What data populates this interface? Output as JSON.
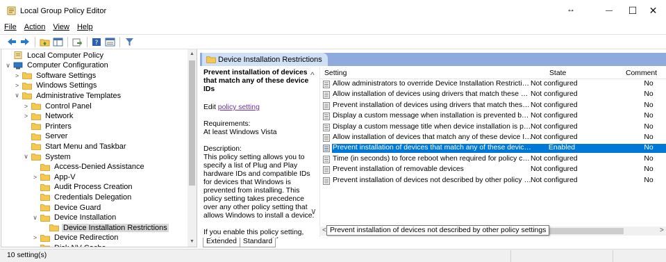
{
  "window": {
    "title": "Local Group Policy Editor",
    "resize_glyph": "↔",
    "minimize": "—",
    "maximize": "☐",
    "close": "✕"
  },
  "menu": [
    "File",
    "Action",
    "View",
    "Help"
  ],
  "toolbar_icons": [
    "back-icon",
    "forward-icon",
    "up-folder-icon",
    "show-hide-tree-icon",
    "export-icon",
    "help-icon",
    "properties-icon",
    "filter-icon"
  ],
  "tree": {
    "items": [
      {
        "label": "Local Computer Policy",
        "chev": "",
        "icon": "policy"
      },
      {
        "label": "Computer Configuration",
        "chev": "∨",
        "icon": "computer"
      },
      {
        "label": "Software Settings",
        "chev": ">",
        "icon": "folder"
      },
      {
        "label": "Windows Settings",
        "chev": ">",
        "icon": "folder"
      },
      {
        "label": "Administrative Templates",
        "chev": "∨",
        "icon": "folder"
      },
      {
        "label": "Control Panel",
        "chev": ">",
        "icon": "folder"
      },
      {
        "label": "Network",
        "chev": ">",
        "icon": "folder"
      },
      {
        "label": "Printers",
        "chev": "",
        "icon": "folder"
      },
      {
        "label": "Server",
        "chev": "",
        "icon": "folder"
      },
      {
        "label": "Start Menu and Taskbar",
        "chev": "",
        "icon": "folder"
      },
      {
        "label": "System",
        "chev": "∨",
        "icon": "folder"
      },
      {
        "label": "Access-Denied Assistance",
        "chev": "",
        "icon": "folder"
      },
      {
        "label": "App-V",
        "chev": ">",
        "icon": "folder"
      },
      {
        "label": "Audit Process Creation",
        "chev": "",
        "icon": "folder"
      },
      {
        "label": "Credentials Delegation",
        "chev": "",
        "icon": "folder"
      },
      {
        "label": "Device Guard",
        "chev": "",
        "icon": "folder"
      },
      {
        "label": "Device Installation",
        "chev": "∨",
        "icon": "folder"
      },
      {
        "label": "Device Installation Restrictions",
        "chev": "",
        "icon": "folder",
        "selected": true
      },
      {
        "label": "Device Redirection",
        "chev": ">",
        "icon": "folder"
      },
      {
        "label": "Disk NV Cache",
        "chev": "",
        "icon": "folder"
      }
    ]
  },
  "header": {
    "tab": "Device Installation Restrictions"
  },
  "description": {
    "title": "Prevent installation of devices that match any of these device IDs",
    "edit_prefix": "Edit ",
    "edit_link": "policy setting",
    "req_label": "Requirements:",
    "req_value": "At least Windows Vista",
    "desc_label": "Description:",
    "desc_text": "This policy setting allows you to specify a list of Plug and Play hardware IDs and compatible IDs for devices that Windows is prevented from installing. This policy setting takes precedence over any other policy setting that allows Windows to install a device.",
    "enable_text": "If you enable this policy setting, Windows is prevented from"
  },
  "list": {
    "columns": {
      "setting": "Setting",
      "state": "State",
      "comment": "Comment"
    },
    "rows": [
      {
        "setting": "Allow administrators to override Device Installation Restriction p...",
        "state": "Not configured",
        "comment": "No"
      },
      {
        "setting": "Allow installation of devices using drivers that match these devi...",
        "state": "Not configured",
        "comment": "No"
      },
      {
        "setting": "Prevent installation of devices using drivers that match these de...",
        "state": "Not configured",
        "comment": "No"
      },
      {
        "setting": "Display a custom message when installation is prevented by a p...",
        "state": "Not configured",
        "comment": "No"
      },
      {
        "setting": "Display a custom message title when device installation is preve...",
        "state": "Not configured",
        "comment": "No"
      },
      {
        "setting": "Allow installation of devices that match any of these device IDs",
        "state": "Not configured",
        "comment": "No"
      },
      {
        "setting": "Prevent installation of devices that match any of these device IDs",
        "state": "Enabled",
        "comment": "No",
        "selected": true
      },
      {
        "setting": "Time (in seconds) to force reboot when required for policy chan...",
        "state": "Not configured",
        "comment": "No"
      },
      {
        "setting": "Prevent installation of removable devices",
        "state": "Not configured",
        "comment": "No"
      },
      {
        "setting": "Prevent installation of devices not described by other policy settings",
        "state": "Not configured",
        "comment": "No"
      }
    ],
    "tooltip": "Prevent installation of devices not described by other policy settings"
  },
  "bottom_tabs": [
    "Extended",
    "Standard"
  ],
  "status": {
    "text": "10 setting(s)"
  },
  "colors": {
    "selection": "#0078d7",
    "header": "#8faadc",
    "tab": "#cfe0f5",
    "folder": "#f5c94f",
    "link": "#7030a0"
  }
}
